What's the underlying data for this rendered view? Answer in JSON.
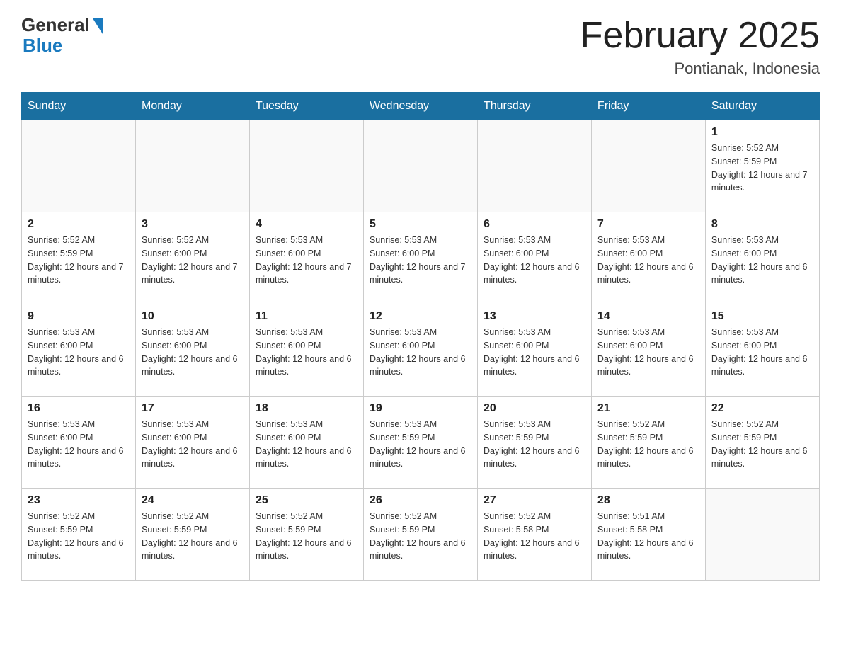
{
  "header": {
    "logo_general": "General",
    "logo_blue": "Blue",
    "month_title": "February 2025",
    "location": "Pontianak, Indonesia"
  },
  "weekdays": [
    "Sunday",
    "Monday",
    "Tuesday",
    "Wednesday",
    "Thursday",
    "Friday",
    "Saturday"
  ],
  "weeks": [
    [
      {
        "day": "",
        "sunrise": "",
        "sunset": "",
        "daylight": ""
      },
      {
        "day": "",
        "sunrise": "",
        "sunset": "",
        "daylight": ""
      },
      {
        "day": "",
        "sunrise": "",
        "sunset": "",
        "daylight": ""
      },
      {
        "day": "",
        "sunrise": "",
        "sunset": "",
        "daylight": ""
      },
      {
        "day": "",
        "sunrise": "",
        "sunset": "",
        "daylight": ""
      },
      {
        "day": "",
        "sunrise": "",
        "sunset": "",
        "daylight": ""
      },
      {
        "day": "1",
        "sunrise": "Sunrise: 5:52 AM",
        "sunset": "Sunset: 5:59 PM",
        "daylight": "Daylight: 12 hours and 7 minutes."
      }
    ],
    [
      {
        "day": "2",
        "sunrise": "Sunrise: 5:52 AM",
        "sunset": "Sunset: 5:59 PM",
        "daylight": "Daylight: 12 hours and 7 minutes."
      },
      {
        "day": "3",
        "sunrise": "Sunrise: 5:52 AM",
        "sunset": "Sunset: 6:00 PM",
        "daylight": "Daylight: 12 hours and 7 minutes."
      },
      {
        "day": "4",
        "sunrise": "Sunrise: 5:53 AM",
        "sunset": "Sunset: 6:00 PM",
        "daylight": "Daylight: 12 hours and 7 minutes."
      },
      {
        "day": "5",
        "sunrise": "Sunrise: 5:53 AM",
        "sunset": "Sunset: 6:00 PM",
        "daylight": "Daylight: 12 hours and 7 minutes."
      },
      {
        "day": "6",
        "sunrise": "Sunrise: 5:53 AM",
        "sunset": "Sunset: 6:00 PM",
        "daylight": "Daylight: 12 hours and 6 minutes."
      },
      {
        "day": "7",
        "sunrise": "Sunrise: 5:53 AM",
        "sunset": "Sunset: 6:00 PM",
        "daylight": "Daylight: 12 hours and 6 minutes."
      },
      {
        "day": "8",
        "sunrise": "Sunrise: 5:53 AM",
        "sunset": "Sunset: 6:00 PM",
        "daylight": "Daylight: 12 hours and 6 minutes."
      }
    ],
    [
      {
        "day": "9",
        "sunrise": "Sunrise: 5:53 AM",
        "sunset": "Sunset: 6:00 PM",
        "daylight": "Daylight: 12 hours and 6 minutes."
      },
      {
        "day": "10",
        "sunrise": "Sunrise: 5:53 AM",
        "sunset": "Sunset: 6:00 PM",
        "daylight": "Daylight: 12 hours and 6 minutes."
      },
      {
        "day": "11",
        "sunrise": "Sunrise: 5:53 AM",
        "sunset": "Sunset: 6:00 PM",
        "daylight": "Daylight: 12 hours and 6 minutes."
      },
      {
        "day": "12",
        "sunrise": "Sunrise: 5:53 AM",
        "sunset": "Sunset: 6:00 PM",
        "daylight": "Daylight: 12 hours and 6 minutes."
      },
      {
        "day": "13",
        "sunrise": "Sunrise: 5:53 AM",
        "sunset": "Sunset: 6:00 PM",
        "daylight": "Daylight: 12 hours and 6 minutes."
      },
      {
        "day": "14",
        "sunrise": "Sunrise: 5:53 AM",
        "sunset": "Sunset: 6:00 PM",
        "daylight": "Daylight: 12 hours and 6 minutes."
      },
      {
        "day": "15",
        "sunrise": "Sunrise: 5:53 AM",
        "sunset": "Sunset: 6:00 PM",
        "daylight": "Daylight: 12 hours and 6 minutes."
      }
    ],
    [
      {
        "day": "16",
        "sunrise": "Sunrise: 5:53 AM",
        "sunset": "Sunset: 6:00 PM",
        "daylight": "Daylight: 12 hours and 6 minutes."
      },
      {
        "day": "17",
        "sunrise": "Sunrise: 5:53 AM",
        "sunset": "Sunset: 6:00 PM",
        "daylight": "Daylight: 12 hours and 6 minutes."
      },
      {
        "day": "18",
        "sunrise": "Sunrise: 5:53 AM",
        "sunset": "Sunset: 6:00 PM",
        "daylight": "Daylight: 12 hours and 6 minutes."
      },
      {
        "day": "19",
        "sunrise": "Sunrise: 5:53 AM",
        "sunset": "Sunset: 5:59 PM",
        "daylight": "Daylight: 12 hours and 6 minutes."
      },
      {
        "day": "20",
        "sunrise": "Sunrise: 5:53 AM",
        "sunset": "Sunset: 5:59 PM",
        "daylight": "Daylight: 12 hours and 6 minutes."
      },
      {
        "day": "21",
        "sunrise": "Sunrise: 5:52 AM",
        "sunset": "Sunset: 5:59 PM",
        "daylight": "Daylight: 12 hours and 6 minutes."
      },
      {
        "day": "22",
        "sunrise": "Sunrise: 5:52 AM",
        "sunset": "Sunset: 5:59 PM",
        "daylight": "Daylight: 12 hours and 6 minutes."
      }
    ],
    [
      {
        "day": "23",
        "sunrise": "Sunrise: 5:52 AM",
        "sunset": "Sunset: 5:59 PM",
        "daylight": "Daylight: 12 hours and 6 minutes."
      },
      {
        "day": "24",
        "sunrise": "Sunrise: 5:52 AM",
        "sunset": "Sunset: 5:59 PM",
        "daylight": "Daylight: 12 hours and 6 minutes."
      },
      {
        "day": "25",
        "sunrise": "Sunrise: 5:52 AM",
        "sunset": "Sunset: 5:59 PM",
        "daylight": "Daylight: 12 hours and 6 minutes."
      },
      {
        "day": "26",
        "sunrise": "Sunrise: 5:52 AM",
        "sunset": "Sunset: 5:59 PM",
        "daylight": "Daylight: 12 hours and 6 minutes."
      },
      {
        "day": "27",
        "sunrise": "Sunrise: 5:52 AM",
        "sunset": "Sunset: 5:58 PM",
        "daylight": "Daylight: 12 hours and 6 minutes."
      },
      {
        "day": "28",
        "sunrise": "Sunrise: 5:51 AM",
        "sunset": "Sunset: 5:58 PM",
        "daylight": "Daylight: 12 hours and 6 minutes."
      },
      {
        "day": "",
        "sunrise": "",
        "sunset": "",
        "daylight": ""
      }
    ]
  ]
}
